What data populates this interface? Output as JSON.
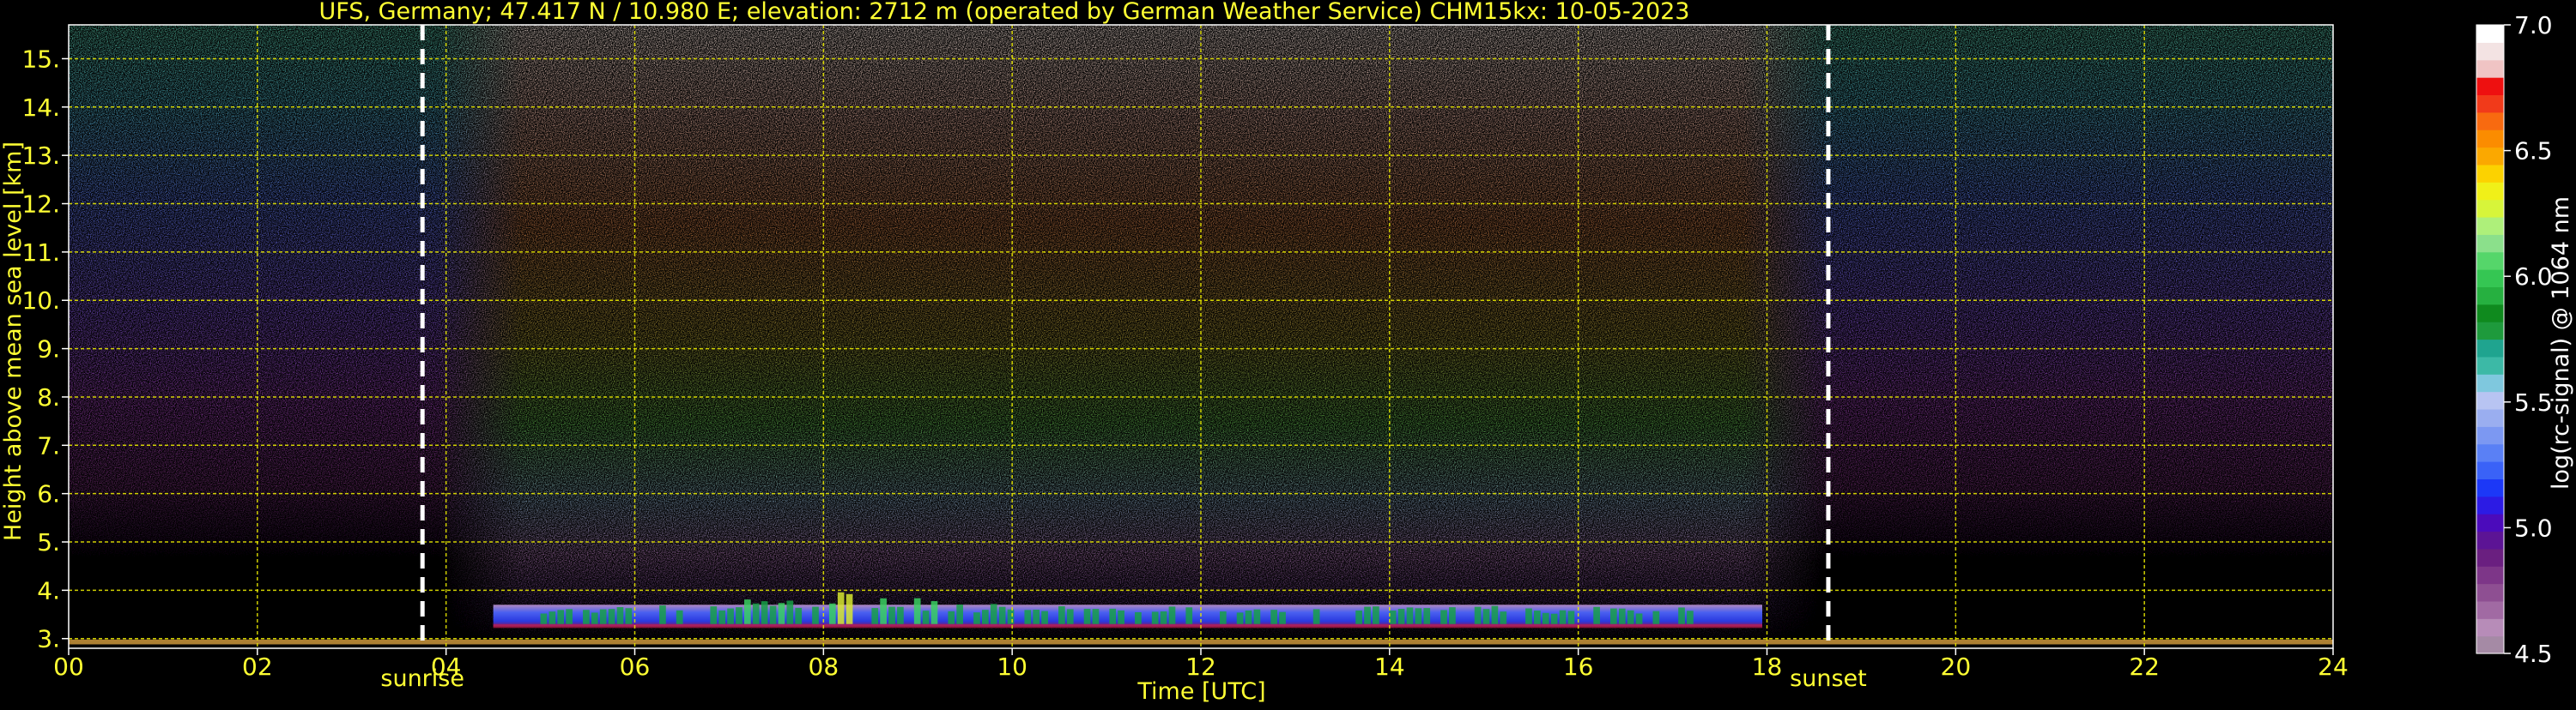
{
  "chart_data": {
    "type": "heatmap",
    "title": "UFS, Germany; 47.417 N / 10.980 E; elevation: 2712 m  (operated by German Weather Service)    CHM15kx: 10-05-2023",
    "xlabel": "Time [UTC]",
    "ylabel": "Height above mean sea level [km]",
    "xlim": [
      0,
      24
    ],
    "ylim": [
      2.8,
      15.7
    ],
    "x_ticks": [
      0,
      2,
      4,
      6,
      8,
      10,
      12,
      14,
      16,
      18,
      20,
      22,
      24
    ],
    "x_tick_labels": [
      "00",
      "02",
      "04",
      "06",
      "08",
      "10",
      "12",
      "14",
      "16",
      "18",
      "20",
      "22",
      "24"
    ],
    "y_ticks": [
      3,
      4,
      5,
      6,
      7,
      8,
      9,
      10,
      11,
      12,
      13,
      14,
      15
    ],
    "y_tick_labels": [
      "3.",
      "4.",
      "5.",
      "6.",
      "7.",
      "8.",
      "9.",
      "10.",
      "11.",
      "12.",
      "13.",
      "14.",
      "15."
    ],
    "grid": true,
    "grid_color": "#e6e600",
    "text_color": "#ffff33",
    "background_color": "#000000",
    "sun_events": [
      {
        "label": "sunrise",
        "time": 3.75
      },
      {
        "label": "sunset",
        "time": 18.65
      }
    ],
    "colorbar": {
      "label": "log(rc-signal) @ 1064 nm",
      "min": 4.5,
      "max": 7.0,
      "ticks": [
        4.5,
        5.0,
        5.5,
        6.0,
        6.5,
        7.0
      ],
      "tick_labels": [
        "4.5",
        "5.0",
        "5.5",
        "6.0",
        "6.5",
        "7.0"
      ],
      "colors": [
        "#a58aa5",
        "#b78cb8",
        "#a16aa3",
        "#8e4f92",
        "#7d3688",
        "#6a1f80",
        "#5c1495",
        "#4b0bbb",
        "#2c1be4",
        "#1c38f7",
        "#3a62f7",
        "#5a80f5",
        "#7c98f2",
        "#9aaef0",
        "#b8c4f2",
        "#7fc8de",
        "#3cb9a6",
        "#1fa48f",
        "#1e9a3c",
        "#0f8a1e",
        "#26b040",
        "#35c653",
        "#55d66a",
        "#8be08b",
        "#aef07a",
        "#d7f53a",
        "#f0f018",
        "#fcd200",
        "#fba800",
        "#fb8c00",
        "#f86a10",
        "#f13a1a",
        "#ee1010",
        "#f0c4c4",
        "#f3e3e3",
        "#ffffff"
      ]
    },
    "cloud_layer": {
      "base_km": 3.25,
      "top_km": 4.0,
      "start_time": 4.5,
      "end_time": 17.95,
      "max_signal_time": 8.1
    },
    "daylight_noise": {
      "start_time": 4.2,
      "end_time": 18.35
    }
  }
}
